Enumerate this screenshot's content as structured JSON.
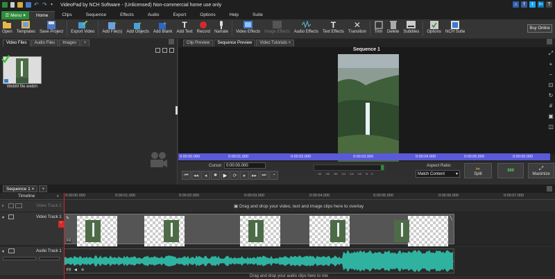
{
  "app": {
    "title": "VideoPad by NCH Software - (Unlicensed) Non-commercial home use only"
  },
  "menu_tabs": {
    "menu_label": "Menu",
    "tabs": [
      "Home",
      "Clips",
      "Sequence",
      "Effects",
      "Audio",
      "Export",
      "Options",
      "Help",
      "Suite"
    ],
    "active": "Home"
  },
  "ribbon": {
    "open": "Open",
    "templates": "Templates",
    "save_project": "Save Project",
    "export_video": "Export Video",
    "add_files": "Add File(s)",
    "add_objects": "Add Objects",
    "add_blank": "Add Blank",
    "add_text": "Add Text",
    "record": "Record",
    "narrate": "Narrate",
    "video_effects": "Video Effects",
    "image_effects": "Image Effects",
    "audio_effects": "Audio Effects",
    "text_effects": "Text Effects",
    "transition": "Transition",
    "trim": "Trim",
    "delete": "Delete",
    "subtitles": "Subtitles",
    "options": "Options",
    "nch_suite": "NCH Suite",
    "buy_online": "Buy Online"
  },
  "media_bin": {
    "tabs": [
      "Video Files",
      "Audio Files",
      "Images",
      "+"
    ],
    "clip_name": "WebM file.webm"
  },
  "preview": {
    "tabs": [
      "Clip Preview",
      "Sequence Preview",
      "Video Tutorials"
    ],
    "title": "Sequence 1",
    "ruler": [
      "0:00:00.000",
      "0:00:01.000",
      "0:00:02.000",
      "0:00:03.000",
      "0:00:04.000",
      "0:00:05.000",
      "0:00:06.000"
    ],
    "cursor_label": "Cursor:",
    "cursor_value": "0:00:00.000",
    "meter_ticks": [
      "-42",
      "-36",
      "-30",
      "-24",
      "-18",
      "-12",
      "-6",
      "0"
    ],
    "aspect_label": "Aspect Ratio:",
    "aspect_value": "Match Content",
    "split": "Split",
    "view360": "360",
    "maximize": "Maximize"
  },
  "timeline": {
    "sequence_tab": "Sequence 1",
    "timeline_label": "Timeline",
    "ruler": [
      "0:00:00.000",
      "0:00:01.000",
      "0:00:02.000",
      "0:00:03.000",
      "0:00:04.000",
      "0:00:05.000",
      "0:00:06.000",
      "0:00:07.000"
    ],
    "video_track2": "Video Track 2",
    "overlay_hint": "Drag and drop your video, text and image clips here to overlay",
    "video_track1": "Video Track 1",
    "audio_track1": "Audio Track 1",
    "audio_hint": "Drag and drop your audio clips here to mix"
  },
  "colors": {
    "accent_green": "#2e8b3a",
    "playhead": "#e02020",
    "preview_bar": "#5a5ad8",
    "waveform": "#2fb3a0"
  }
}
